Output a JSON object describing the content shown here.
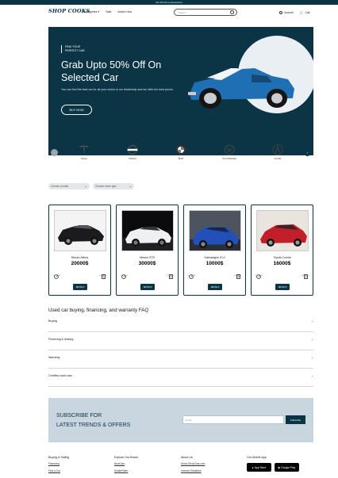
{
  "topbar": {
    "text": "Get 10% Off on selected items"
  },
  "header": {
    "logo": "SHOP COOKS",
    "nav": [
      "Categories",
      "Sale",
      "what's new"
    ],
    "search_placeholder": "Search",
    "account": "Account",
    "cart": "Cart"
  },
  "hero": {
    "tag_line1": "FIND YOUR",
    "tag_line2": "PERFECT CAR",
    "title_line1": "Grab Upto 50% Off On",
    "title_line2": "Selected Car",
    "description": "You can find the best car for all your needs in our dealership and we offer the best prices.",
    "button": "BUY NOW"
  },
  "brands": {
    "items": [
      {
        "name": "TESLA",
        "icon": "tesla-logo"
      },
      {
        "name": "NISSAN",
        "icon": "nissan-logo"
      },
      {
        "name": "BMW",
        "icon": "bmw-logo"
      },
      {
        "name": "VOLKSWAGEN",
        "icon": "volkswagen-logo"
      },
      {
        "name": "ACURA",
        "icon": "acura-logo"
      }
    ],
    "prev_color": "#9aa3ab",
    "next_color": "#0b3545"
  },
  "filters": [
    "Choose a make",
    "Choose motor type"
  ],
  "cards": [
    {
      "name": "Nissan Altima",
      "price": "20000$",
      "left_label": "2021 4x4",
      "right_label": "automatic",
      "button": "DETAILS"
    },
    {
      "name": "Nissan GTR",
      "price": "30000$",
      "left_label": "2021 4x4",
      "right_label": "automatic",
      "button": "DETAILS"
    },
    {
      "name": "Volkswagen ID.4",
      "price": "10000$",
      "left_label": "2021 4x4",
      "right_label": "automatic",
      "button": "DETAILS"
    },
    {
      "name": "Toyota Corolla",
      "price": "16000$",
      "left_label": "2021 4x4",
      "right_label": "automatic",
      "button": "DETAILS"
    }
  ],
  "faq": {
    "title": "Used car buying, financing, and warranty FAQ",
    "items": [
      "Buying",
      "Financing & leasing",
      "Warranty",
      "Certified used cars"
    ]
  },
  "subscribe": {
    "title_line1": "SUBSCRIBE FOR",
    "title_line2": "LATEST TRENDS & OFFERS",
    "placeholder": "Email",
    "button": "Subscribe"
  },
  "footer": {
    "col1": {
      "title": "Buying & Selling",
      "links": [
        "Financing",
        "Find a Car"
      ]
    },
    "col2": {
      "title": "Explore Our Brand",
      "links": [
        "NewCars",
        "DealerRater"
      ]
    },
    "col3": {
      "title": "About Us",
      "links": [
        "About ShopCars.com",
        "Investor Relations"
      ]
    },
    "col4": {
      "title": "Our Mobile App",
      "appstore": "App Store",
      "googleplay": "Google Play"
    }
  },
  "colors": {
    "primary": "#0b3545",
    "subscribe_bg": "#c9d5df"
  }
}
